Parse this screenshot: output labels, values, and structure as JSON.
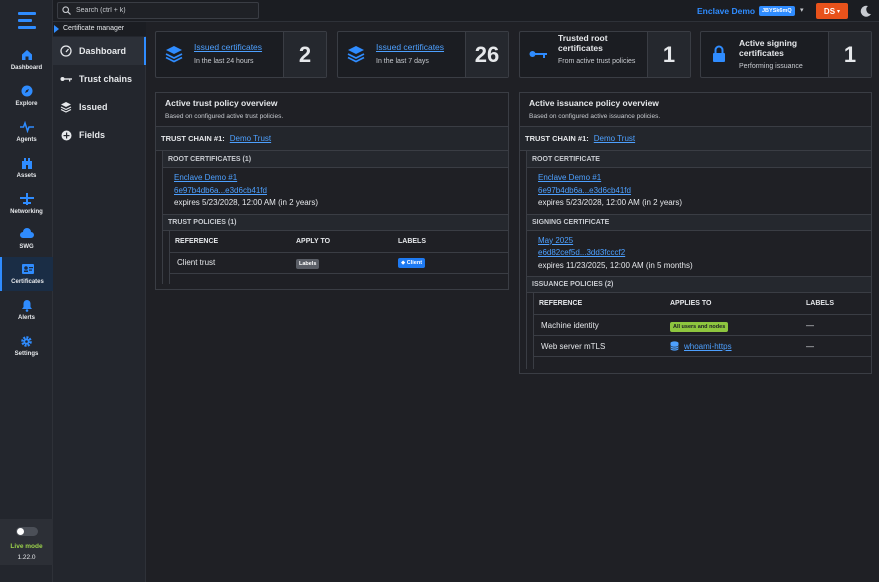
{
  "rail": {
    "items": [
      {
        "label": "Dashboard",
        "icon": "home-icon"
      },
      {
        "label": "Explore",
        "icon": "compass-icon"
      },
      {
        "label": "Agents",
        "icon": "pulse-icon"
      },
      {
        "label": "Assets",
        "icon": "building-icon"
      },
      {
        "label": "Networking",
        "icon": "network-icon"
      },
      {
        "label": "SWG",
        "icon": "cloud-icon"
      },
      {
        "label": "Certificates",
        "icon": "certificate-icon"
      },
      {
        "label": "Alerts",
        "icon": "bell-icon"
      },
      {
        "label": "Settings",
        "icon": "gear-icon"
      }
    ],
    "active": "Certificates",
    "live_mode": "Live mode",
    "version": "1.22.0"
  },
  "sub": {
    "title": "Certificate manager",
    "items": [
      {
        "label": "Dashboard"
      },
      {
        "label": "Trust chains"
      },
      {
        "label": "Issued"
      },
      {
        "label": "Fields"
      }
    ]
  },
  "topbar": {
    "search_placeholder": "Search (ctrl + k)",
    "org_name": "Enclave Demo",
    "org_id": "JBYSk6mQ",
    "user_initials": "DS"
  },
  "cards": [
    {
      "title": "Issued certificates",
      "subtitle": "In the last 24 hours",
      "value": "2"
    },
    {
      "title": "Issued certificates",
      "subtitle": "In the last 7 days",
      "value": "26"
    },
    {
      "title": "Trusted root certificates",
      "subtitle": "From active trust policies",
      "value": "1"
    },
    {
      "title": "Active signing certificates",
      "subtitle": "Performing issuance",
      "value": "1"
    }
  ],
  "trust": {
    "title": "Active trust policy overview",
    "subtitle": "Based on configured active trust policies.",
    "chain_label": "TRUST CHAIN #1:",
    "chain_link": "Demo Trust",
    "root_header": "ROOT CERTIFICATES (1)",
    "root_name": "Enclave Demo #1",
    "root_hash": "6e97b4db6a...e3d6cb41fd",
    "root_expiry": "expires 5/23/2028, 12:00 AM (in 2 years)",
    "policies_header": "TRUST POLICIES (1)",
    "columns": [
      "REFERENCE",
      "APPLY TO",
      "LABELS"
    ],
    "rows": [
      {
        "reference": "Client trust",
        "apply_to": "Labels",
        "label": "Client"
      }
    ]
  },
  "issuance": {
    "title": "Active issuance policy overview",
    "subtitle": "Based on configured active issuance policies.",
    "chain_label": "TRUST CHAIN #1:",
    "chain_link": "Demo Trust",
    "root_header": "ROOT CERTIFICATE",
    "root_name": "Enclave Demo #1",
    "root_hash": "6e97b4db6a...e3d6cb41fd",
    "root_expiry": "expires 5/23/2028, 12:00 AM (in 2 years)",
    "signing_header": "SIGNING CERTIFICATE",
    "signing_name": "May 2025",
    "signing_hash": "e6d82cef5d...3dd3fcccf2",
    "signing_expiry": "expires 11/23/2025, 12:00 AM (in 5 months)",
    "policies_header": "ISSUANCE POLICIES (2)",
    "columns": [
      "REFERENCE",
      "APPLIES TO",
      "LABELS"
    ],
    "rows": [
      {
        "reference": "Machine identity",
        "applies_to": "All users and nodes",
        "labels": "—"
      },
      {
        "reference": "Web server mTLS",
        "applies_to": "whoami-https",
        "labels": "—"
      }
    ]
  },
  "colors": {
    "accent": "#2f8cff",
    "user_button": "#e8521b",
    "live_green": "#9bd14b",
    "background": "#1f2025"
  }
}
